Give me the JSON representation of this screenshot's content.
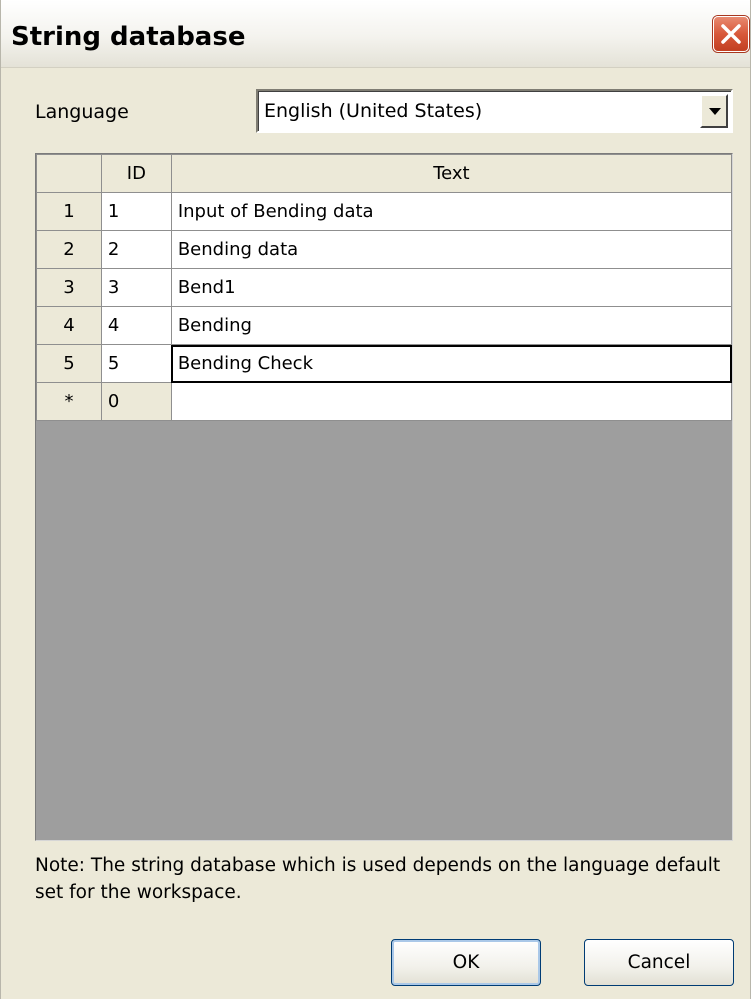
{
  "window": {
    "title": "String database",
    "close_icon": "close-icon"
  },
  "language": {
    "label": "Language",
    "selected": "English (United States)",
    "dropdown_icon": "chevron-down-icon"
  },
  "grid": {
    "columns": [
      "ID",
      "Text"
    ],
    "rows": [
      {
        "row_header": "1",
        "id": "1",
        "text": "Input of Bending data"
      },
      {
        "row_header": "2",
        "id": "2",
        "text": "Bending data"
      },
      {
        "row_header": "3",
        "id": "3",
        "text": "Bend1"
      },
      {
        "row_header": "4",
        "id": "4",
        "text": "Bending"
      },
      {
        "row_header": "5",
        "id": "5",
        "text": "Bending Check"
      }
    ],
    "new_row": {
      "row_header": "*",
      "id": "0",
      "text": ""
    }
  },
  "note": "Note: The string database which is used depends on the language default set for the workspace.",
  "buttons": {
    "ok": "OK",
    "cancel": "Cancel"
  },
  "colors": {
    "dialog_background": "#ece9d8",
    "grid_empty_area": "#9e9e9e",
    "close_button": "#d8583a"
  }
}
